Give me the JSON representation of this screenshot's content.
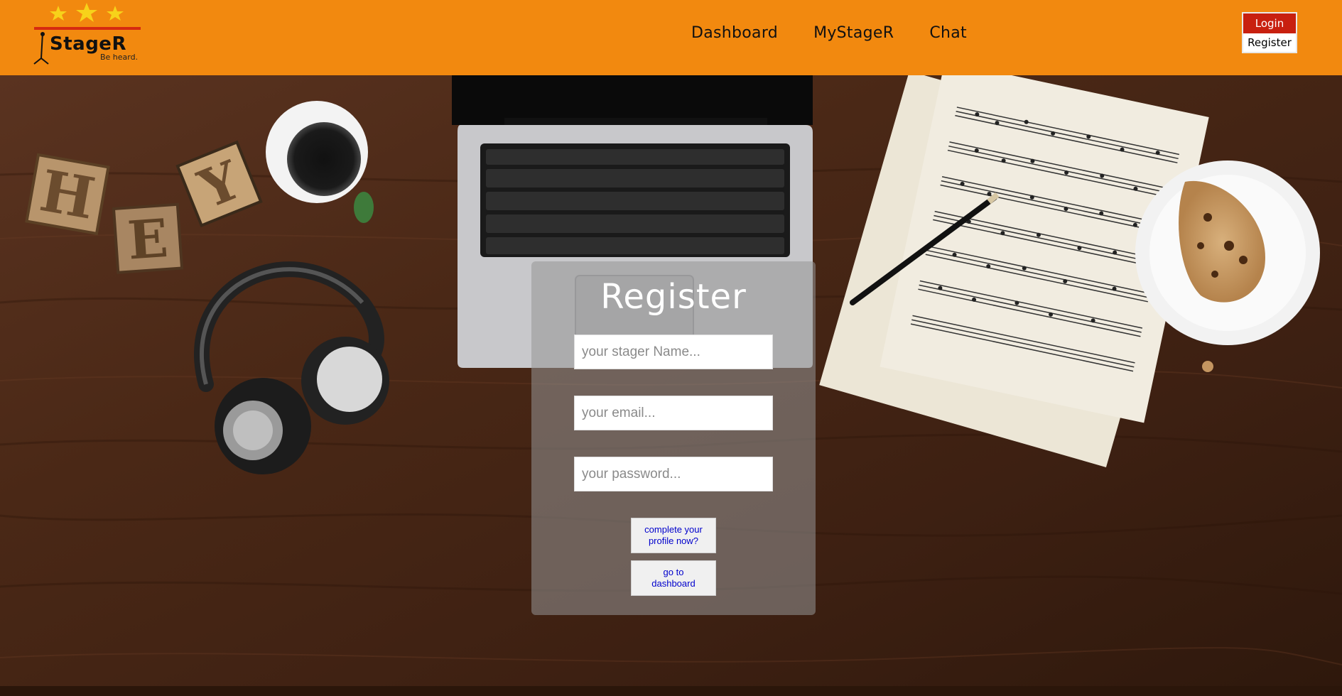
{
  "brand": {
    "name": "StageR",
    "tagline": "Be heard."
  },
  "nav": {
    "items": [
      {
        "label": "Dashboard"
      },
      {
        "label": "MyStageR"
      },
      {
        "label": "Chat"
      }
    ]
  },
  "auth": {
    "login_label": "Login",
    "register_label": "Register"
  },
  "register_form": {
    "title": "Register",
    "name_placeholder": "your stager Name...",
    "email_placeholder": "your email...",
    "password_placeholder": "your password...",
    "complete_profile_label": "complete your profile now?",
    "dashboard_label": "go to dashboard"
  },
  "background": {
    "letter_blocks": [
      "H",
      "E",
      "Y"
    ]
  },
  "colors": {
    "header": "#f2890f",
    "login_button": "#c8200f",
    "link_text": "#0000cc",
    "wood": "#4a2a1a"
  }
}
